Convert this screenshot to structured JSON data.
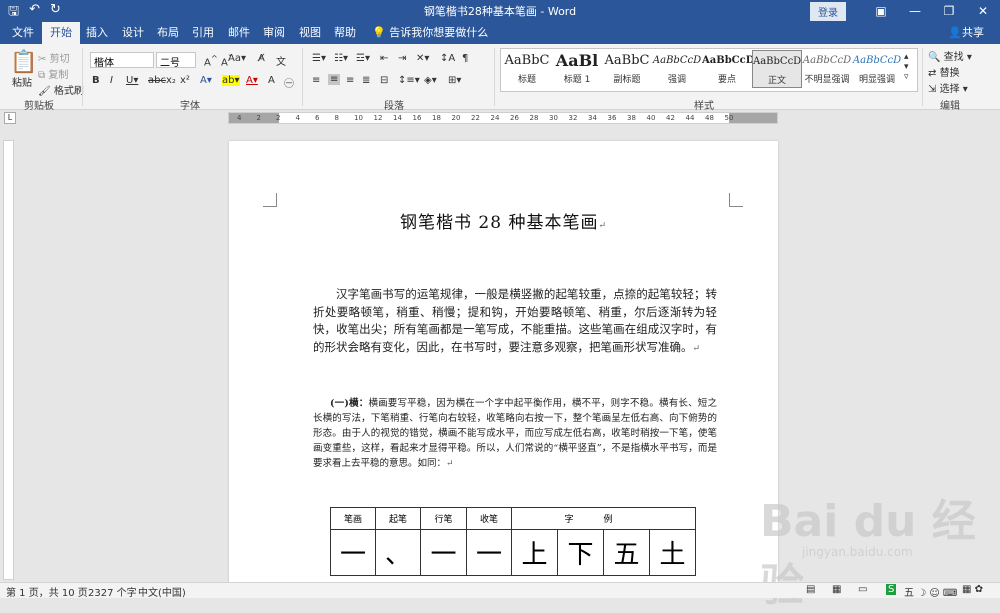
{
  "window": {
    "title": "钢笔楷书28种基本笔画 - Word",
    "login": "登录"
  },
  "qat": {
    "save": "🖫",
    "undo": "↶",
    "redo": "↻"
  },
  "tabs": [
    "文件",
    "开始",
    "插入",
    "设计",
    "布局",
    "引用",
    "邮件",
    "审阅",
    "视图",
    "帮助"
  ],
  "tell_me": "告诉我你想要做什么",
  "share": "共享",
  "ribbon": {
    "clipboard": {
      "label": "剪贴板",
      "paste": "粘贴",
      "cut": "剪切",
      "copy": "复制",
      "format_painter": "格式刷"
    },
    "font": {
      "label": "字体",
      "font_name": "楷体",
      "font_size": "二号"
    },
    "paragraph": {
      "label": "段落"
    },
    "styles": {
      "label": "样式",
      "items": [
        {
          "sample": "AaBbC",
          "name": "标题"
        },
        {
          "sample": "AaBl",
          "name": "标题 1"
        },
        {
          "sample": "AaBbC",
          "name": "副标题"
        },
        {
          "sample": "AaBbCcD",
          "name": "强调"
        },
        {
          "sample": "AaBbCcD",
          "name": "要点"
        },
        {
          "sample": "AaBbCcD",
          "name": "正文"
        },
        {
          "sample": "AaBbCcD",
          "name": "不明显强调"
        },
        {
          "sample": "AaBbCcD",
          "name": "明显强调"
        }
      ]
    },
    "editing": {
      "label": "编辑",
      "find": "查找",
      "replace": "替换",
      "select": "选择"
    }
  },
  "ruler": [
    "4",
    "2",
    "2",
    "4",
    "6",
    "8",
    "10",
    "12",
    "14",
    "16",
    "18",
    "20",
    "22",
    "24",
    "26",
    "28",
    "30",
    "32",
    "34",
    "36",
    "38",
    "40",
    "42",
    "44",
    "48",
    "50"
  ],
  "document": {
    "title": "钢笔楷书 28 种基本笔画",
    "para1": "汉字笔画书写的运笔规律，一般是横竖撇的起笔较重，点捺的起笔较轻；转折处要略顿笔，稍重、稍慢；提和钩，开始要略顿笔、稍重，尔后逐渐转为轻快，收笔出尖；所有笔画都是一笔写成，不能重描。这些笔画在组成汉字时，有的形状会略有变化，因此，在书写时，要注意多观察，把笔画形状写准确。",
    "para2_lead": "(一)横：",
    "para2": "横画要写平稳，因为横在一个字中起平衡作用，横不平，则字不稳。横有长、短之长横的写法，下笔稍重、行笔向右较轻，收笔略向右按一下，整个笔画呈左低右高、向下俯势的形态。由于人的视觉的错觉，横画不能写成水平，而应写成左低右高，收笔时稍按一下笔，使笔画变重些，这样，看起来才显得平稳。所以，人们常说的“横平竖直”，不是指横水平书写，而是要求看上去平稳的意思。如同：",
    "table": {
      "headers": [
        "笔画",
        "起笔",
        "行笔",
        "收笔",
        "字",
        "例"
      ],
      "cells": [
        "一",
        "、",
        "一",
        "一",
        "上",
        "下",
        "五",
        "土"
      ]
    }
  },
  "status": {
    "page": "第 1 页，共 10 页",
    "words": "2327 个字",
    "language": "中文(中国)"
  },
  "watermark": {
    "logo": "Bai du 经验",
    "url": "jingyan.baidu.com"
  }
}
